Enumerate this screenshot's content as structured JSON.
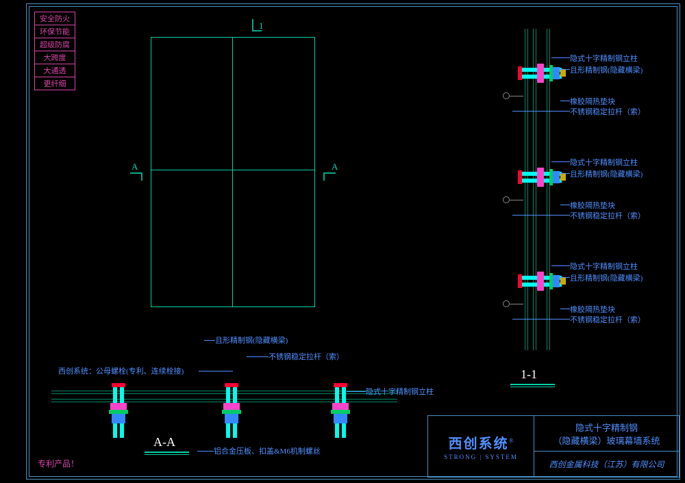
{
  "tags": [
    "安全防火",
    "环保节能",
    "超级防腐",
    "大跨度",
    "大通透",
    "更纤细"
  ],
  "markers": {
    "top": "1",
    "left": "A",
    "right": "A"
  },
  "sections": {
    "aa": "A-A",
    "oneone": "1-1"
  },
  "labels": {
    "sys_bolt": "西创系统：公母螺栓(专利、连续栓接)",
    "beam": "且形精制钢(隐藏横梁)",
    "rod": "不锈钢稳定拉杆（索）",
    "column": "隐式十字精制钢立柱",
    "plate": "铝合金压板、扣盖&M6机制螺丝",
    "gasket": "橡胶隔热垫块"
  },
  "patent": "专利产品！",
  "titleblock": {
    "brand": "西创系统",
    "reg": "®",
    "brand_en": "STRONG | SYSTEM",
    "title1": "隐式十字精制钢",
    "title2": "（隐藏横梁）玻璃幕墙系统",
    "company": "西创金属科技（江苏）有限公司"
  }
}
